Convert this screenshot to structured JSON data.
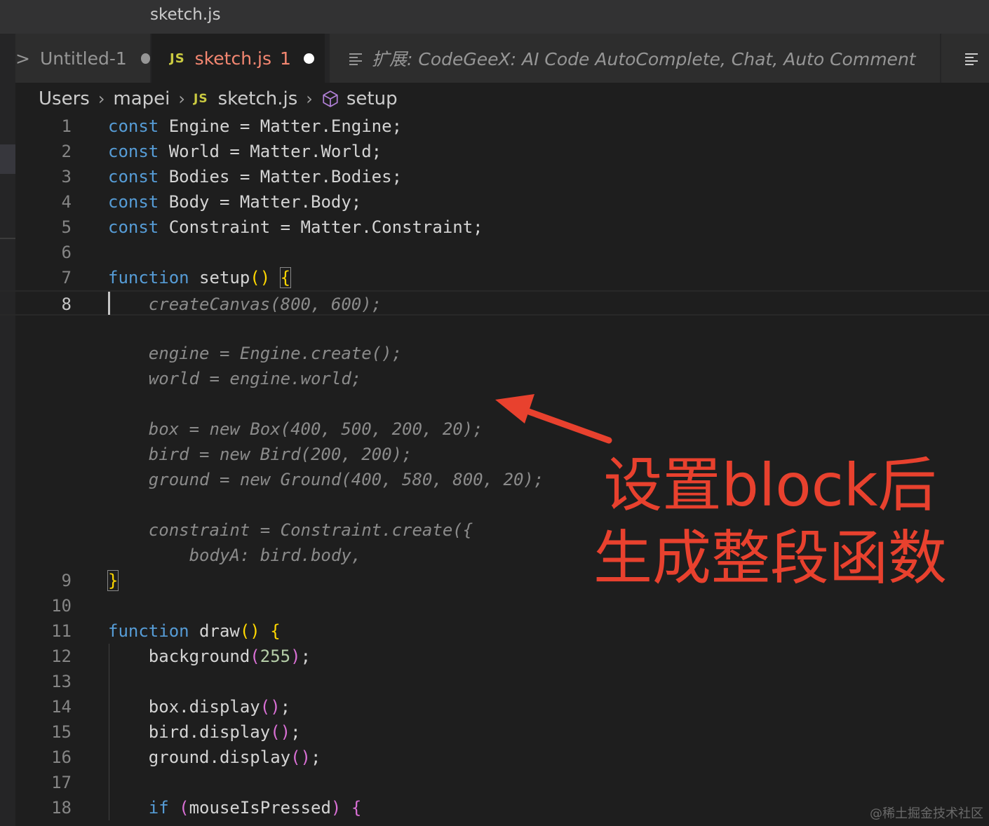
{
  "window": {
    "title": "sketch.js"
  },
  "tabs": [
    {
      "prefix": ">",
      "label": "Untitled-1"
    },
    {
      "badge": "JS",
      "label": "sketch.js",
      "problems": "1"
    },
    {
      "label": "扩展: CodeGeeX: AI Code AutoComplete, Chat, Auto Comment"
    }
  ],
  "breadcrumb": {
    "items": [
      "Users",
      "mapei",
      "sketch.js",
      "setup"
    ],
    "file_badge": "JS"
  },
  "code_lines": [
    {
      "n": "1",
      "tokens": [
        [
          "kw",
          "const"
        ],
        [
          "var",
          " Engine = Matter.Engine;"
        ]
      ]
    },
    {
      "n": "2",
      "tokens": [
        [
          "kw",
          "const"
        ],
        [
          "var",
          " World = Matter.World;"
        ]
      ]
    },
    {
      "n": "3",
      "tokens": [
        [
          "kw",
          "const"
        ],
        [
          "var",
          " Bodies = Matter.Bodies;"
        ]
      ]
    },
    {
      "n": "4",
      "tokens": [
        [
          "kw",
          "const"
        ],
        [
          "var",
          " Body = Matter.Body;"
        ]
      ]
    },
    {
      "n": "5",
      "tokens": [
        [
          "kw",
          "const"
        ],
        [
          "var",
          " Constraint = Matter.Constraint;"
        ]
      ]
    },
    {
      "n": "6",
      "tokens": []
    },
    {
      "n": "7",
      "tokens": [
        [
          "kw",
          "function"
        ],
        [
          "var",
          " setup"
        ],
        [
          "brace",
          "()"
        ],
        [
          "var",
          " "
        ],
        [
          "bracebox",
          "{"
        ]
      ]
    },
    {
      "n": "8",
      "tokens": [
        [
          "ghost",
          "    createCanvas(800, 600);"
        ]
      ]
    },
    {
      "n": "",
      "tokens": []
    },
    {
      "n": "",
      "tokens": [
        [
          "ghost",
          "    engine = Engine.create();"
        ]
      ]
    },
    {
      "n": "",
      "tokens": [
        [
          "ghost",
          "    world = engine.world;"
        ]
      ]
    },
    {
      "n": "",
      "tokens": []
    },
    {
      "n": "",
      "tokens": [
        [
          "ghost",
          "    box = new Box(400, 500, 200, 20);"
        ]
      ]
    },
    {
      "n": "",
      "tokens": [
        [
          "ghost",
          "    bird = new Bird(200, 200);"
        ]
      ]
    },
    {
      "n": "",
      "tokens": [
        [
          "ghost",
          "    ground = new Ground(400, 580, 800, 20);"
        ]
      ]
    },
    {
      "n": "",
      "tokens": []
    },
    {
      "n": "",
      "tokens": [
        [
          "ghost",
          "    constraint = Constraint.create({"
        ]
      ]
    },
    {
      "n": "",
      "tokens": [
        [
          "ghost",
          "        bodyA: bird.body,"
        ]
      ]
    },
    {
      "n": "9",
      "tokens": [
        [
          "bracebox",
          "}"
        ]
      ]
    },
    {
      "n": "10",
      "tokens": []
    },
    {
      "n": "11",
      "tokens": [
        [
          "kw",
          "function"
        ],
        [
          "var",
          " draw"
        ],
        [
          "brace",
          "()"
        ],
        [
          "var",
          " "
        ],
        [
          "brace",
          "{"
        ]
      ]
    },
    {
      "n": "12",
      "tokens": [
        [
          "var",
          "    background"
        ],
        [
          "paren",
          "("
        ],
        [
          "num",
          "255"
        ],
        [
          "paren",
          ")"
        ],
        [
          "var",
          ";"
        ]
      ]
    },
    {
      "n": "13",
      "tokens": []
    },
    {
      "n": "14",
      "tokens": [
        [
          "var",
          "    box.display"
        ],
        [
          "paren",
          "()"
        ],
        [
          "var",
          ";"
        ]
      ]
    },
    {
      "n": "15",
      "tokens": [
        [
          "var",
          "    bird.display"
        ],
        [
          "paren",
          "()"
        ],
        [
          "var",
          ";"
        ]
      ]
    },
    {
      "n": "16",
      "tokens": [
        [
          "var",
          "    ground.display"
        ],
        [
          "paren",
          "()"
        ],
        [
          "var",
          ";"
        ]
      ]
    },
    {
      "n": "17",
      "tokens": []
    },
    {
      "n": "18",
      "tokens": [
        [
          "kw",
          "    if"
        ],
        [
          "var",
          " "
        ],
        [
          "paren",
          "("
        ],
        [
          "var",
          "mouseIsPressed"
        ],
        [
          "paren",
          ")"
        ],
        [
          "var",
          " "
        ],
        [
          "paren",
          "{"
        ]
      ]
    }
  ],
  "annotation": {
    "line1": "设置block后",
    "line2": "生成整段函数"
  },
  "watermark": "@稀土掘金技术社区",
  "colors": {
    "keyword": "#569cd6",
    "ghost_text": "#8b8b8b",
    "annotation": "#e8412e",
    "modified_tab": "#f48771"
  }
}
